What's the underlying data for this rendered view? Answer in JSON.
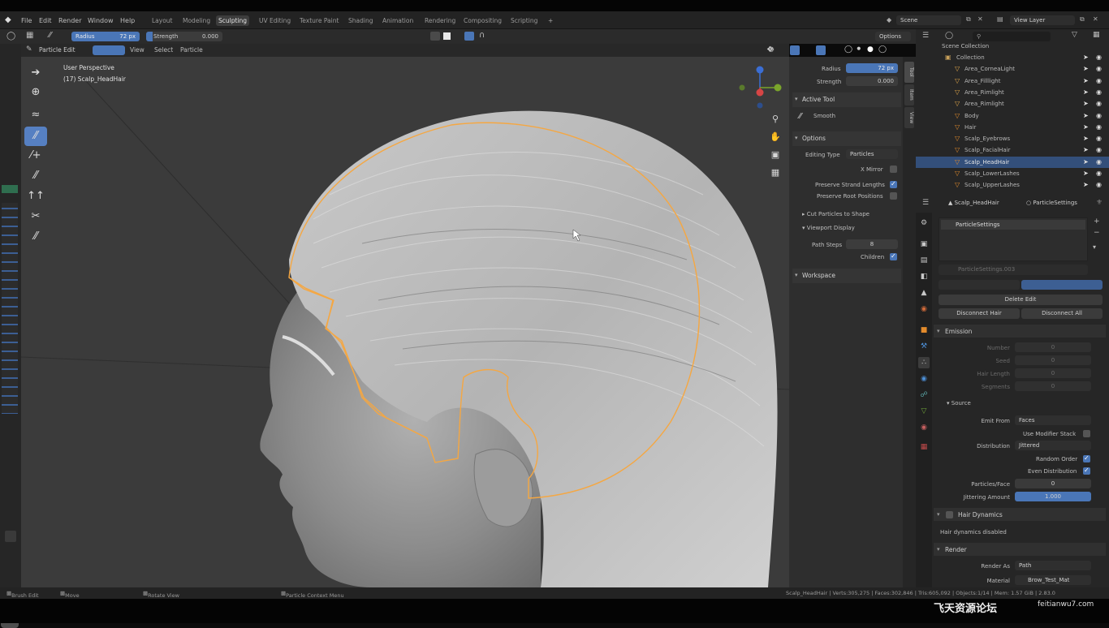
{
  "menu": {
    "items": [
      "File",
      "Edit",
      "Render",
      "Window",
      "Help"
    ]
  },
  "workspaces": [
    "Layout",
    "Modeling",
    "Sculpting",
    "UV Editing",
    "Texture Paint",
    "Shading",
    "Animation",
    "Rendering",
    "Compositing",
    "Scripting"
  ],
  "active_workspace": "Sculpting",
  "scene_field": "Scene",
  "view_layer_field": "View Layer",
  "header": {
    "radius_label": "Radius",
    "radius_value": "72 px",
    "strength_label": "Strength",
    "strength_value": "0.000",
    "options": "Options"
  },
  "header2": {
    "mode": "Particle Edit",
    "menus": [
      "View",
      "Select",
      "Particle"
    ]
  },
  "viewport": {
    "perspective": "User Perspective",
    "object": "(17) Scalp_HeadHair"
  },
  "npanel": {
    "radius_label": "Radius",
    "radius_value": "72 px",
    "strength_label": "Strength",
    "strength_value": "0.000",
    "active_tool_header": "Active Tool",
    "active_tool_name": "Smooth",
    "options_header": "Options",
    "editing_type_label": "Editing Type",
    "editing_type_value": "Particles",
    "x_mirror": "X Mirror",
    "preserve_strand": "Preserve Strand Lengths",
    "preserve_root": "Preserve Root Positions",
    "cut_particles": "Cut Particles to Shape",
    "viewport_display": "Viewport Display",
    "path_steps_label": "Path Steps",
    "path_steps_value": "8",
    "children": "Children",
    "workspace": "Workspace",
    "tabs": [
      "Tool",
      "Item",
      "View"
    ]
  },
  "outliner": {
    "title": "Scene Collection",
    "rows": [
      {
        "name": "Collection",
        "selected": false
      },
      {
        "name": "Area_CorneaLight",
        "selected": false
      },
      {
        "name": "Area_Filllight",
        "selected": false
      },
      {
        "name": "Area_Rimlight",
        "selected": false
      },
      {
        "name": "Area_Rimlight",
        "selected": false
      },
      {
        "name": "Body",
        "selected": false
      },
      {
        "name": "Hair",
        "selected": false
      },
      {
        "name": "Scalp_Eyebrows",
        "selected": false
      },
      {
        "name": "Scalp_FacialHair",
        "selected": false
      },
      {
        "name": "Scalp_HeadHair",
        "selected": true
      },
      {
        "name": "Scalp_LowerLashes",
        "selected": false
      },
      {
        "name": "Scalp_UpperLashes",
        "selected": false
      }
    ]
  },
  "properties": {
    "object": "Scalp_HeadHair",
    "settings": "ParticleSettings",
    "list_item": "ParticleSettings",
    "datablock": "ParticleSettings.003",
    "delete_edit": "Delete Edit",
    "disconnect_hair": "Disconnect Hair",
    "disconnect_all": "Disconnect All",
    "emission": "Emission",
    "number_label": "Number",
    "number_value": "0",
    "seed_label": "Seed",
    "seed_value": "0",
    "hair_length_label": "Hair Length",
    "hair_length_value": "0",
    "segments_label": "Segments",
    "segments_value": "0",
    "source": "Source",
    "emit_from_label": "Emit From",
    "emit_from_value": "Faces",
    "use_modifier_stack": "Use Modifier Stack",
    "distribution_label": "Distribution",
    "distribution_value": "Jittered",
    "random_order": "Random Order",
    "even_distribution": "Even Distribution",
    "particles_face_label": "Particles/Face",
    "particles_face_value": "0",
    "jittering_label": "Jittering Amount",
    "jittering_value": "1.000",
    "hair_dynamics": "Hair Dynamics",
    "hair_dynamics_msg": "Hair dynamics disabled",
    "render": "Render",
    "render_as_label": "Render As",
    "render_as_value": "Path",
    "material_label": "Material",
    "material_value": "Brow_Test_Mat"
  },
  "status": {
    "left1": "Brush Edit",
    "left2": "Move",
    "left3": "Rotate View",
    "left4": "Particle Context Menu",
    "right": "Scalp_HeadHair | Verts:305,275 | Faces:302,846 | Tris:605,092 | Objects:1/14 | Mem: 1.57 GiB | 2.83.0"
  },
  "watermark": {
    "cn": "飞天资源论坛",
    "url": "feitianwu7.com"
  },
  "colors": {
    "accent": "#4a76b7",
    "selection": "#f5a742",
    "viewport": "#3b3b3b"
  }
}
